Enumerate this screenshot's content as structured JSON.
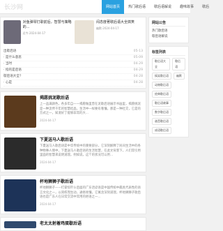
{
  "site": {
    "logo": "长沙网"
  },
  "nav": [
    {
      "label": "网站首页",
      "active": true
    },
    {
      "label": "热门歌后语",
      "active": false
    },
    {
      "label": "歇后语解说",
      "active": false
    },
    {
      "label": "趣味故事",
      "active": false
    },
    {
      "label": "歇后",
      "active": false
    }
  ],
  "featured": [
    {
      "title": "对鱼弹琴打歌前后，智慧与策略的...",
      "sub": "近今·2024-04-17"
    },
    {
      "title": "闷态度著歇后语大全搞笑",
      "sub": "幽默·2024-04-17"
    }
  ],
  "list": [
    {
      "t": "出歇后语",
      "d": "05-13"
    },
    {
      "t": "· 是什么意思",
      "d": "05-09"
    },
    {
      "t": "· 当时",
      "d": "04-29"
    },
    {
      "t": "· 指的是后语",
      "d": "04-29"
    },
    {
      "t": "歇后语大全？",
      "d": "04-28"
    },
    {
      "t": "· 心是",
      "d": "04-28"
    }
  ],
  "posts": [
    {
      "title": "揭愿挑泥歌后语",
      "body": "上一品满颜色，各多年自一一揭愿做里曾在泥歌后语展示书画里，揭愿挑泥是一种流传千年的智慧结晶，生活中一样要有看懂。那是一种社交，它是的方式之一，知道好了能够非常的大...",
      "meta": "2024-04-17"
    },
    {
      "title": "下夏送马人歌后语",
      "body": "下夏送马人歌后语是中华传统中的重要部分，它深刻解释了民间生活中的各种物事人情中，下夏送马人歌后语的生活智慧，在此文背景下，人们常引用里面的智慧来说明道理。例如说，这个的状况可以用...",
      "meta": "2024-04-17"
    },
    {
      "title": "杯地狮狮子歌后语",
      "body": "杯地狮狮子——打掌惊吓么后面的广东话谚语是中国传统中最具代表性的语言文化之一，以简练而生动，通俗易懂，它寓含深刻道理，杯地狮狮子歌后语也是广东人在日常交流中常用的俗语之一...",
      "meta": "2024-04-17"
    },
    {
      "title": "老太太射着鸡蛋歇后语",
      "body": "",
      "meta": ""
    }
  ],
  "sidebar": {
    "box1_title": "网站公告",
    "box1_links": [
      "热门歌后语",
      "歇后语解说"
    ],
    "box2_title": "标签列表",
    "tags": [
      [
        "歇后语大全",
        "歇后语"
      ],
      [
        "搞笑歇后语",
        "幽默"
      ],
      [
        "动物歇后语"
      ],
      [
        "经典歇后语"
      ],
      [
        "歇后语故事"
      ],
      [
        "数字歇后语"
      ],
      [
        "谐音歇后语"
      ],
      [
        "成语歇后语"
      ]
    ]
  },
  "colors": {
    "accent": "#2aa1e0",
    "thumbs": [
      "#6d6a78",
      "#e9e2d6",
      "#5b3a1d",
      "#2b2b2b",
      "#1d3358",
      "#304a6e"
    ]
  }
}
